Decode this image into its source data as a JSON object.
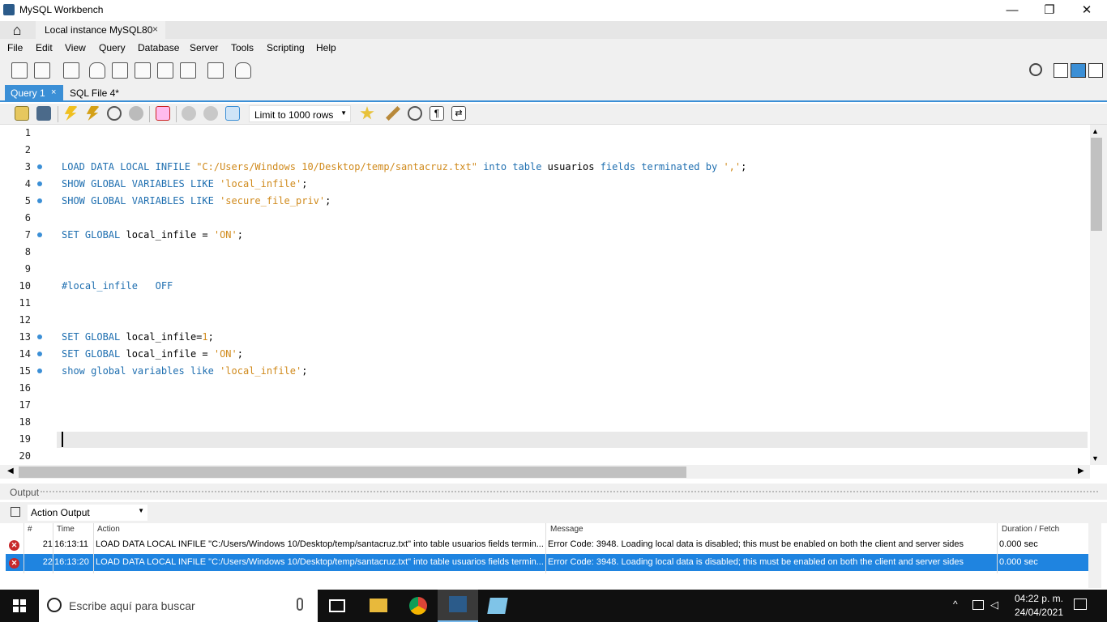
{
  "window": {
    "title": "MySQL Workbench",
    "minimize_icon": "minimize-icon",
    "maximize_icon": "restore-icon",
    "close_icon": "close-icon",
    "minimize_glyph": "—",
    "restore_glyph": "❐",
    "close_glyph": "✕"
  },
  "app_tabs": {
    "home_glyph": "⌂",
    "instance_tab": "Local instance MySQL80",
    "close_glyph": "×"
  },
  "menu": [
    "File",
    "Edit",
    "View",
    "Query",
    "Database",
    "Server",
    "Tools",
    "Scripting",
    "Help"
  ],
  "editor_tabs": {
    "active": "Query 1",
    "active_close": "×",
    "other": "SQL File 4*"
  },
  "editor_toolbar": {
    "limit_label": "Limit to 1000 rows",
    "dropdown_glyph": "▼"
  },
  "editor": {
    "line_numbers": [
      "1",
      "2",
      "3",
      "4",
      "5",
      "6",
      "7",
      "8",
      "9",
      "10",
      "11",
      "12",
      "13",
      "14",
      "15",
      "16",
      "17",
      "18",
      "19",
      "20"
    ]
  },
  "output": {
    "header": "Output",
    "selector": "Action Output",
    "dropdown_glyph": "▼",
    "columns": [
      "#",
      "Time",
      "Action",
      "Message",
      "Duration / Fetch"
    ],
    "rows": [
      {
        "num": "21",
        "time": "16:13:11",
        "action": "LOAD DATA LOCAL INFILE \"C:/Users/Windows 10/Desktop/temp/santacruz.txt\" into table usuarios fields termin...",
        "message": "Error Code: 3948. Loading local data is disabled; this must be enabled on both the client and server sides",
        "duration": "0.000 sec"
      },
      {
        "num": "22",
        "time": "16:13:20",
        "action": "LOAD DATA LOCAL INFILE \"C:/Users/Windows 10/Desktop/temp/santacruz.txt\" into table usuarios fields termin...",
        "message": "Error Code: 3948. Loading local data is disabled; this must be enabled on both the client and server sides",
        "duration": "0.000 sec"
      }
    ]
  },
  "taskbar": {
    "search_placeholder": "Escribe aquí para buscar",
    "time": "04:22 p. m.",
    "date": "24/04/2021"
  },
  "colors": {
    "accent": "#3b8fd6",
    "keyword": "#1f6fb0",
    "string": "#d08a1c",
    "error": "#c8282a",
    "selection": "#1f84e0"
  }
}
